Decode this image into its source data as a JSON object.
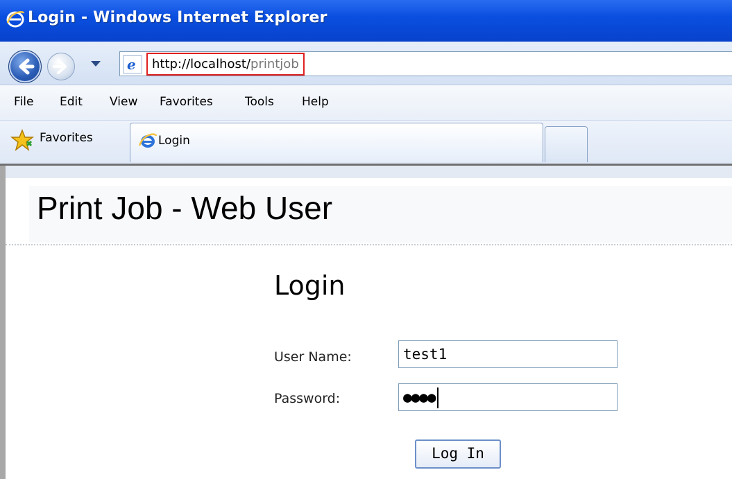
{
  "window": {
    "title": "Login - Windows Internet Explorer"
  },
  "address_bar": {
    "url_host": "http://localhost/",
    "url_path": "printjob"
  },
  "menu": [
    "File",
    "Edit",
    "View",
    "Favorites",
    "Tools",
    "Help"
  ],
  "favorites_bar": {
    "label": "Favorites"
  },
  "tabs": [
    {
      "label": "Login"
    }
  ],
  "page": {
    "header_title": "Print Job - Web User",
    "login_heading": "Login",
    "username_label": "User Name:",
    "username_value": "test1",
    "password_label": "Password:",
    "password_masked": "●●●●",
    "login_button": "Log In"
  },
  "colors": {
    "titlebar": "#0a4fe0",
    "address_highlight": "#e02020"
  }
}
